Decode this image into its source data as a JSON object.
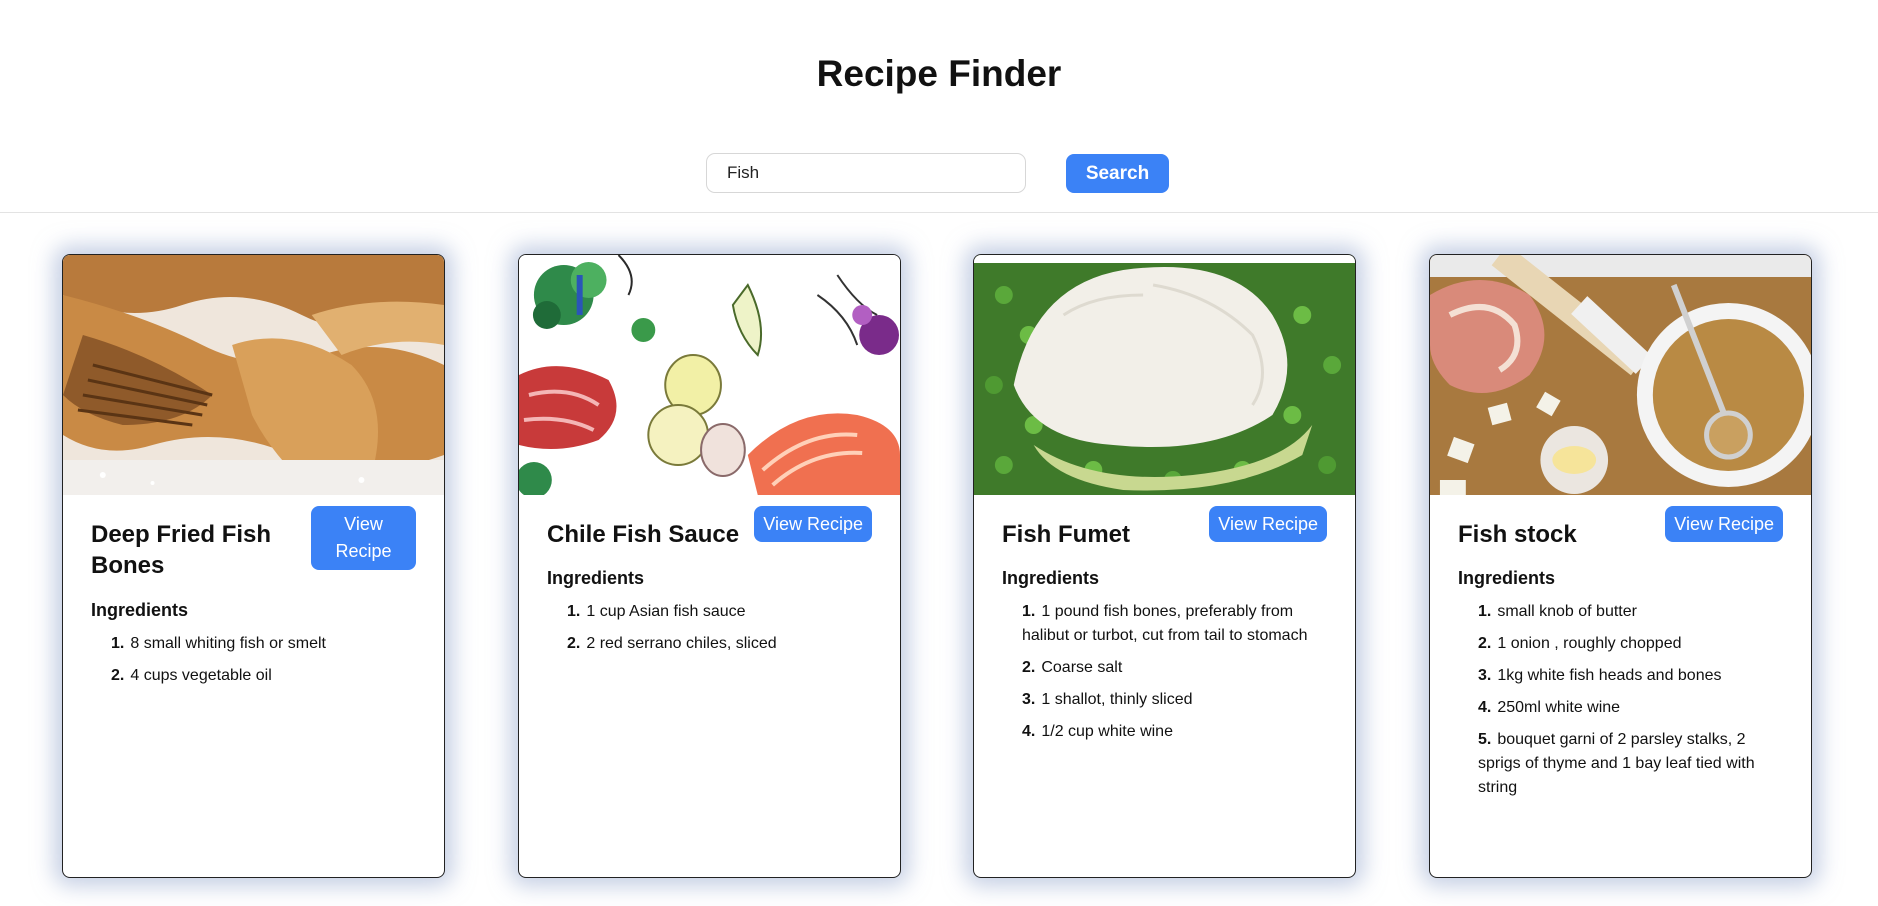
{
  "header": {
    "title": "Recipe Finder"
  },
  "search": {
    "value": "Fish",
    "button_label": "Search"
  },
  "colors": {
    "accent": "#3b82f6",
    "card_shadow": "#96a8cd"
  },
  "ingredients_heading": "Ingredients",
  "recipes": [
    {
      "title": "Deep Fried Fish Bones",
      "button_label": "View Recipe",
      "image": "fried-fish-bones-photo",
      "ingredients": [
        {
          "num": "1.",
          "text": "8 small whiting fish or smelt"
        },
        {
          "num": "2.",
          "text": "4 cups vegetable oil"
        }
      ]
    },
    {
      "title": "Chile Fish Sauce",
      "button_label": "View Recipe",
      "image": "watercolor-vegetables-illustration",
      "ingredients": [
        {
          "num": "1.",
          "text": "1 cup Asian fish sauce"
        },
        {
          "num": "2.",
          "text": "2 red serrano chiles, sliced"
        }
      ]
    },
    {
      "title": "Fish Fumet",
      "button_label": "View Recipe",
      "image": "poached-fish-with-peas-photo",
      "ingredients": [
        {
          "num": "1.",
          "text": "1 pound fish bones, preferably from halibut or turbot, cut from tail to stomach"
        },
        {
          "num": "2.",
          "text": "Coarse salt"
        },
        {
          "num": "3.",
          "text": "1 shallot, thinly sliced"
        },
        {
          "num": "4.",
          "text": "1/2 cup white wine"
        }
      ]
    },
    {
      "title": "Fish stock",
      "button_label": "View Recipe",
      "image": "fish-stock-pot-photo",
      "ingredients": [
        {
          "num": "1.",
          "text": "small knob of butter"
        },
        {
          "num": "2.",
          "text": "1 onion , roughly chopped"
        },
        {
          "num": "3.",
          "text": "1kg white fish heads and bones"
        },
        {
          "num": "4.",
          "text": "250ml white wine"
        },
        {
          "num": "5.",
          "text": "bouquet garni of 2 parsley stalks, 2 sprigs of thyme and 1 bay leaf tied with string"
        }
      ]
    }
  ]
}
